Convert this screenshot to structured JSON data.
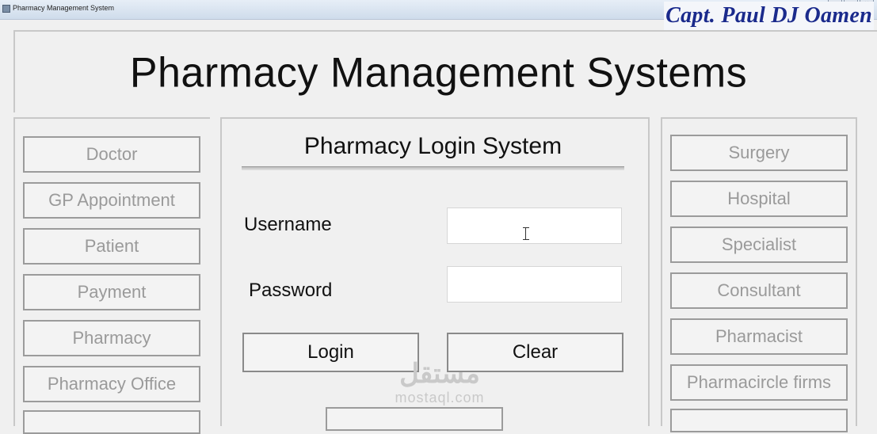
{
  "window": {
    "title": "Pharmacy Management System",
    "controls": [
      "–",
      "□",
      "✕"
    ]
  },
  "author": "Capt. Paul DJ Oamen",
  "header": {
    "title": "Pharmacy Management Systems"
  },
  "left_nav": {
    "items": [
      {
        "label": "Doctor"
      },
      {
        "label": "GP Appointment"
      },
      {
        "label": "Patient"
      },
      {
        "label": "Payment"
      },
      {
        "label": "Pharmacy"
      },
      {
        "label": "Pharmacy Office"
      }
    ]
  },
  "right_nav": {
    "items": [
      {
        "label": "Surgery"
      },
      {
        "label": "Hospital"
      },
      {
        "label": "Specialist"
      },
      {
        "label": "Consultant"
      },
      {
        "label": "Pharmacist"
      },
      {
        "label": "Pharmacircle firms"
      }
    ]
  },
  "login": {
    "title": "Pharmacy Login System",
    "username_label": "Username",
    "username_value": "",
    "password_label": "Password",
    "password_value": "",
    "login_label": "Login",
    "clear_label": "Clear"
  },
  "watermark": {
    "arabic": "مستقل",
    "latin": "mostaql.com"
  },
  "colors": {
    "author": "#1a2a8c",
    "disabled_text": "#9a9a9a",
    "background": "#f0f0f0"
  }
}
